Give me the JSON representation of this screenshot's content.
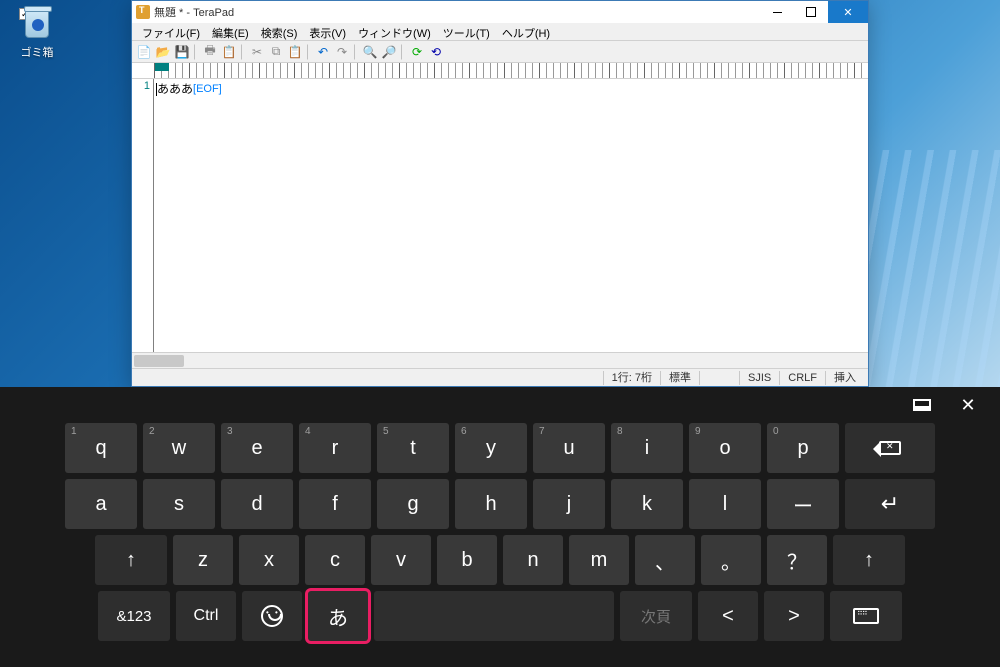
{
  "desktop": {
    "recycle_bin": "ゴミ箱"
  },
  "window": {
    "title": "無題 * - TeraPad",
    "menu": {
      "file": "ファイル(F)",
      "edit": "編集(E)",
      "search": "検索(S)",
      "view": "表示(V)",
      "window": "ウィンドウ(W)",
      "tool": "ツール(T)",
      "help": "ヘルプ(H)"
    },
    "editor": {
      "line_number": "1",
      "text": "あああ",
      "eof": "[EOF]"
    },
    "status": {
      "pos": "1行: 7桁",
      "mode": "標準",
      "encoding": "SJIS",
      "newline": "CRLF",
      "insert": "挿入"
    }
  },
  "osk": {
    "row1": [
      {
        "num": "1",
        "key": "q"
      },
      {
        "num": "2",
        "key": "w"
      },
      {
        "num": "3",
        "key": "e"
      },
      {
        "num": "4",
        "key": "r"
      },
      {
        "num": "5",
        "key": "t"
      },
      {
        "num": "6",
        "key": "y"
      },
      {
        "num": "7",
        "key": "u"
      },
      {
        "num": "8",
        "key": "i"
      },
      {
        "num": "9",
        "key": "o"
      },
      {
        "num": "0",
        "key": "p"
      }
    ],
    "row2": [
      "a",
      "s",
      "d",
      "f",
      "g",
      "h",
      "j",
      "k",
      "l",
      "ー"
    ],
    "row3": [
      "z",
      "x",
      "c",
      "v",
      "b",
      "n",
      "m",
      "、",
      "。",
      "？"
    ],
    "row4": {
      "num_mode": "&123",
      "ctrl": "Ctrl",
      "ime": "あ",
      "convert": "次頁",
      "left": "<",
      "right": ">"
    }
  }
}
